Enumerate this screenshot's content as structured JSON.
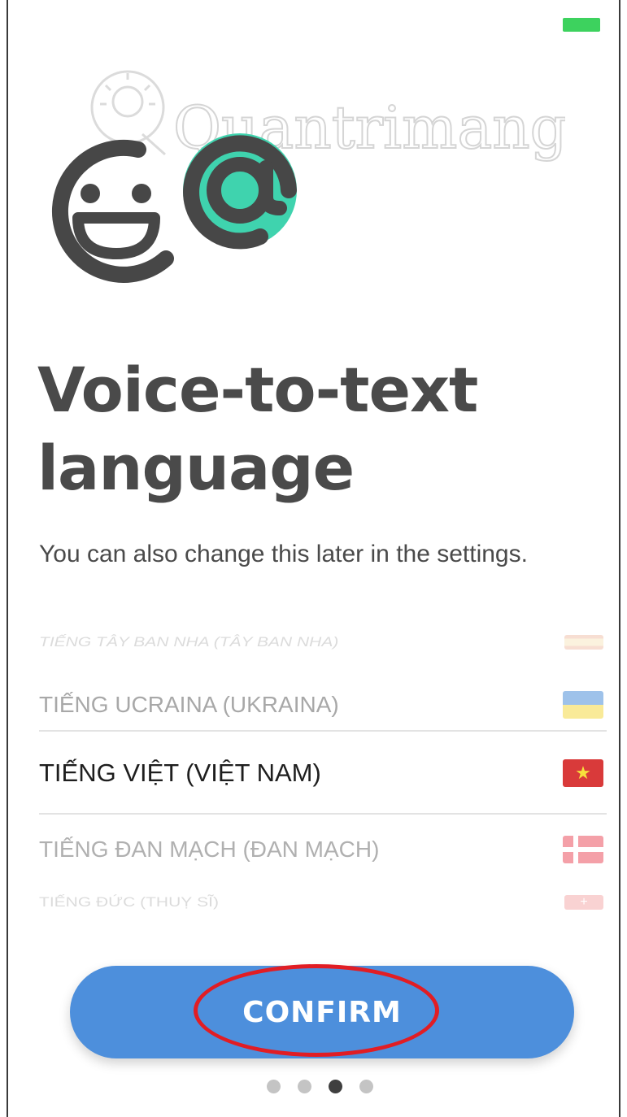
{
  "status_bar": {
    "battery_color": "#3dd25e"
  },
  "watermark": {
    "text": "Quantrimang"
  },
  "logo": {
    "icon": "smiley-at-logo",
    "accent_color": "#3fd3ae",
    "ink_color": "#474747"
  },
  "header": {
    "title_line1": "Voice-to-text",
    "title_line2": "language",
    "subtitle": "You can also change this later in the settings."
  },
  "languages": [
    {
      "label": "TIẾNG TÂY BAN NHA (TÂY BAN NHA)",
      "flag": "spain-flag-icon"
    },
    {
      "label": "TIẾNG UCRAINA (UKRAINA)",
      "flag": "ukraine-flag-icon"
    },
    {
      "label": "TIẾNG VIỆT (VIỆT NAM)",
      "flag": "vietnam-flag-icon",
      "selected": true
    },
    {
      "label": "TIẾNG ĐAN MẠCH (ĐAN MẠCH)",
      "flag": "denmark-flag-icon"
    },
    {
      "label": "TIẾNG ĐỨC (THUỴ SĨ)",
      "flag": "switzerland-flag-icon"
    }
  ],
  "confirm_button": {
    "label": "CONFIRM",
    "color": "#4d8fdc",
    "highlight_color": "#e11d24"
  },
  "pagination": {
    "total": 4,
    "current": 3
  }
}
